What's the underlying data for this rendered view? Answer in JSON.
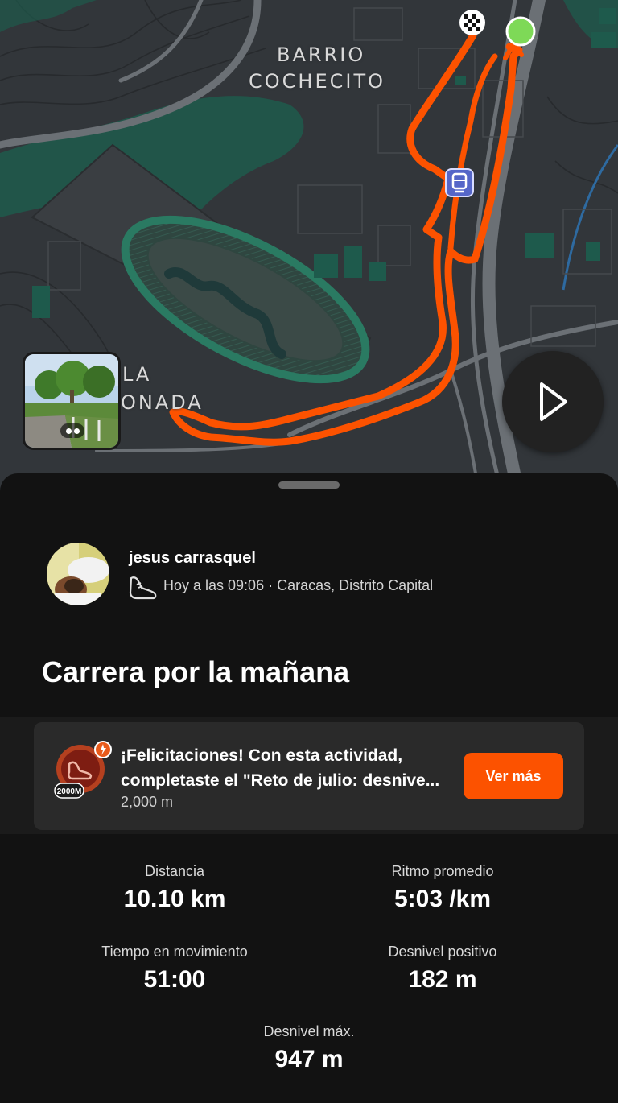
{
  "map": {
    "labels": [
      "BARRIO",
      "COCHECITO",
      "LA",
      "ONADA"
    ],
    "colors": {
      "background": "#32363a",
      "green": "#1e5a4c",
      "route": "#fc5200",
      "start": "#7ed957"
    },
    "icons": {
      "play": "play-icon",
      "finish": "finish-flag-icon",
      "start": "start-dot-icon",
      "transit": "metro-station-icon"
    }
  },
  "athlete": {
    "name": "jesus carrasquel",
    "meta": "Hoy a las 09:06 · Caracas, Distrito Capital",
    "sport_icon": "running-shoe-icon"
  },
  "activity": {
    "title": "Carrera por la mañana"
  },
  "achievement": {
    "line1": "¡Felicitaciones! Con esta actividad,",
    "line2": "completaste el \"Reto de julio: desnive...",
    "line3": "2,000 m",
    "badge_text": "2000M",
    "button": "Ver más",
    "accent": "#fc5200"
  },
  "stats": [
    {
      "label": "Distancia",
      "value": "10.10 km"
    },
    {
      "label": "Ritmo promedio",
      "value": "5:03 /km"
    },
    {
      "label": "Tiempo en movimiento",
      "value": "51:00"
    },
    {
      "label": "Desnivel positivo",
      "value": "182 m"
    },
    {
      "label": "Desnivel máx.",
      "value": "947 m"
    }
  ]
}
